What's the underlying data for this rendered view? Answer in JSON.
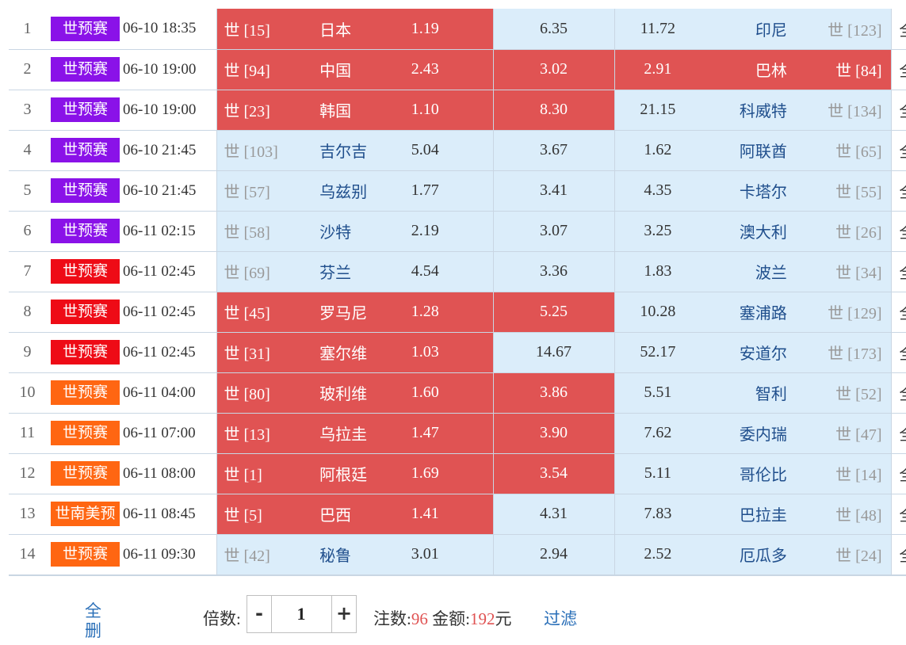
{
  "colors": {
    "selected": "#e05353",
    "unselected": "#dbedfa",
    "purple": "#8a12e8",
    "red": "#ee0b16",
    "orange": "#ff6612"
  },
  "extra_col_text": "全",
  "matches": [
    {
      "idx": "1",
      "league": "世预赛",
      "league_color": "#8a12e8",
      "time": "06-10 18:35",
      "home_rank": "世 [15]",
      "home": "日本",
      "home_odds": "1.19",
      "draw_odds": "6.35",
      "away_odds": "11.72",
      "away": "印尼",
      "away_rank": "世 [123]",
      "home_sel": true,
      "draw_sel": false,
      "away_sel": false
    },
    {
      "idx": "2",
      "league": "世预赛",
      "league_color": "#8a12e8",
      "time": "06-10 19:00",
      "home_rank": "世 [94]",
      "home": "中国",
      "home_odds": "2.43",
      "draw_odds": "3.02",
      "away_odds": "2.91",
      "away": "巴林",
      "away_rank": "世 [84]",
      "home_sel": true,
      "draw_sel": true,
      "away_sel": true
    },
    {
      "idx": "3",
      "league": "世预赛",
      "league_color": "#8a12e8",
      "time": "06-10 19:00",
      "home_rank": "世 [23]",
      "home": "韩国",
      "home_odds": "1.10",
      "draw_odds": "8.30",
      "away_odds": "21.15",
      "away": "科威特",
      "away_rank": "世 [134]",
      "home_sel": true,
      "draw_sel": true,
      "away_sel": false
    },
    {
      "idx": "4",
      "league": "世预赛",
      "league_color": "#8a12e8",
      "time": "06-10 21:45",
      "home_rank": "世 [103]",
      "home": "吉尔吉",
      "home_odds": "5.04",
      "draw_odds": "3.67",
      "away_odds": "1.62",
      "away": "阿联酋",
      "away_rank": "世 [65]",
      "home_sel": false,
      "draw_sel": false,
      "away_sel": false
    },
    {
      "idx": "5",
      "league": "世预赛",
      "league_color": "#8a12e8",
      "time": "06-10 21:45",
      "home_rank": "世 [57]",
      "home": "乌兹别",
      "home_odds": "1.77",
      "draw_odds": "3.41",
      "away_odds": "4.35",
      "away": "卡塔尔",
      "away_rank": "世 [55]",
      "home_sel": false,
      "draw_sel": false,
      "away_sel": false
    },
    {
      "idx": "6",
      "league": "世预赛",
      "league_color": "#8a12e8",
      "time": "06-11 02:15",
      "home_rank": "世 [58]",
      "home": "沙特",
      "home_odds": "2.19",
      "draw_odds": "3.07",
      "away_odds": "3.25",
      "away": "澳大利",
      "away_rank": "世 [26]",
      "home_sel": false,
      "draw_sel": false,
      "away_sel": false
    },
    {
      "idx": "7",
      "league": "世预赛",
      "league_color": "#ee0b16",
      "time": "06-11 02:45",
      "home_rank": "世 [69]",
      "home": "芬兰",
      "home_odds": "4.54",
      "draw_odds": "3.36",
      "away_odds": "1.83",
      "away": "波兰",
      "away_rank": "世 [34]",
      "home_sel": false,
      "draw_sel": false,
      "away_sel": false
    },
    {
      "idx": "8",
      "league": "世预赛",
      "league_color": "#ee0b16",
      "time": "06-11 02:45",
      "home_rank": "世 [45]",
      "home": "罗马尼",
      "home_odds": "1.28",
      "draw_odds": "5.25",
      "away_odds": "10.28",
      "away": "塞浦路",
      "away_rank": "世 [129]",
      "home_sel": true,
      "draw_sel": true,
      "away_sel": false
    },
    {
      "idx": "9",
      "league": "世预赛",
      "league_color": "#ee0b16",
      "time": "06-11 02:45",
      "home_rank": "世 [31]",
      "home": "塞尔维",
      "home_odds": "1.03",
      "draw_odds": "14.67",
      "away_odds": "52.17",
      "away": "安道尔",
      "away_rank": "世 [173]",
      "home_sel": true,
      "draw_sel": false,
      "away_sel": false
    },
    {
      "idx": "10",
      "league": "世预赛",
      "league_color": "#ff6612",
      "time": "06-11 04:00",
      "home_rank": "世 [80]",
      "home": "玻利维",
      "home_odds": "1.60",
      "draw_odds": "3.86",
      "away_odds": "5.51",
      "away": "智利",
      "away_rank": "世 [52]",
      "home_sel": true,
      "draw_sel": true,
      "away_sel": false
    },
    {
      "idx": "11",
      "league": "世预赛",
      "league_color": "#ff6612",
      "time": "06-11 07:00",
      "home_rank": "世 [13]",
      "home": "乌拉圭",
      "home_odds": "1.47",
      "draw_odds": "3.90",
      "away_odds": "7.62",
      "away": "委内瑞",
      "away_rank": "世 [47]",
      "home_sel": true,
      "draw_sel": true,
      "away_sel": false
    },
    {
      "idx": "12",
      "league": "世预赛",
      "league_color": "#ff6612",
      "time": "06-11 08:00",
      "home_rank": "世 [1]",
      "home": "阿根廷",
      "home_odds": "1.69",
      "draw_odds": "3.54",
      "away_odds": "5.11",
      "away": "哥伦比",
      "away_rank": "世 [14]",
      "home_sel": true,
      "draw_sel": true,
      "away_sel": false
    },
    {
      "idx": "13",
      "league": "世南美预",
      "league_color": "#ff6612",
      "time": "06-11 08:45",
      "home_rank": "世 [5]",
      "home": "巴西",
      "home_odds": "1.41",
      "draw_odds": "4.31",
      "away_odds": "7.83",
      "away": "巴拉圭",
      "away_rank": "世 [48]",
      "home_sel": true,
      "draw_sel": false,
      "away_sel": false
    },
    {
      "idx": "14",
      "league": "世预赛",
      "league_color": "#ff6612",
      "time": "06-11 09:30",
      "home_rank": "世 [42]",
      "home": "秘鲁",
      "home_odds": "3.01",
      "draw_odds": "2.94",
      "away_odds": "2.52",
      "away": "厄瓜多",
      "away_rank": "世 [24]",
      "home_sel": false,
      "draw_sel": false,
      "away_sel": false
    }
  ],
  "footer": {
    "delete_all_line1": "全",
    "delete_all_line2": "删",
    "multiplier_label": "倍数:",
    "minus": "-",
    "multiplier_value": "1",
    "plus": "+",
    "bets_label": "注数:",
    "bets_value": "96",
    "amount_label": "金额:",
    "amount_value": "192",
    "amount_unit": "元",
    "filter_label": "过滤"
  }
}
